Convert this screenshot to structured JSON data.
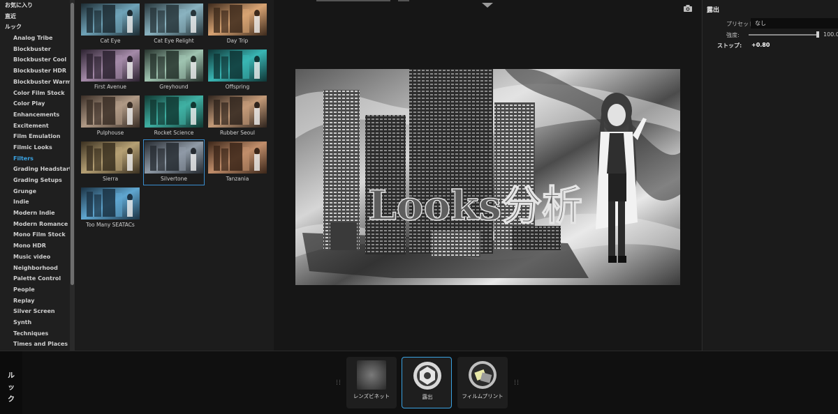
{
  "sidebar": {
    "categories": [
      {
        "label": "お気に入り"
      },
      {
        "label": "直近"
      },
      {
        "label": "ルック"
      }
    ],
    "items": [
      {
        "label": "Analog Tribe"
      },
      {
        "label": "Blockbuster"
      },
      {
        "label": "Blockbuster Cool"
      },
      {
        "label": "Blockbuster HDR"
      },
      {
        "label": "Blockbuster Warm"
      },
      {
        "label": "Color Film Stock"
      },
      {
        "label": "Color Play"
      },
      {
        "label": "Enhancements"
      },
      {
        "label": "Excitement"
      },
      {
        "label": "Film Emulation"
      },
      {
        "label": "Filmic Looks"
      },
      {
        "label": "Filters",
        "active": true
      },
      {
        "label": "Grading Headstarts"
      },
      {
        "label": "Grading Setups"
      },
      {
        "label": "Grunge"
      },
      {
        "label": "Indie"
      },
      {
        "label": "Modern Indie"
      },
      {
        "label": "Modern Romance"
      },
      {
        "label": "Mono Film Stock"
      },
      {
        "label": "Mono HDR"
      },
      {
        "label": "Music video"
      },
      {
        "label": "Neighborhood"
      },
      {
        "label": "Palette Control"
      },
      {
        "label": "People"
      },
      {
        "label": "Replay"
      },
      {
        "label": "Silver Screen"
      },
      {
        "label": "Synth"
      },
      {
        "label": "Techniques"
      },
      {
        "label": "Times and Places"
      }
    ]
  },
  "looks": [
    {
      "label": "Cat Eye",
      "tint": "#6fa3b8",
      "tone": "#1d2c33"
    },
    {
      "label": "Cat Eye Relight",
      "tint": "#8ab3c0",
      "tone": "#27353a"
    },
    {
      "label": "Day Trip",
      "tint": "#d7a373",
      "tone": "#3d2a1c"
    },
    {
      "label": "First Avenue",
      "tint": "#a48aa8",
      "tone": "#2c2230"
    },
    {
      "label": "Greyhound",
      "tint": "#9fc3b0",
      "tone": "#26322c"
    },
    {
      "label": "Offspring",
      "tint": "#39b5b3",
      "tone": "#0f3535"
    },
    {
      "label": "Pulphouse",
      "tint": "#b09a86",
      "tone": "#3a2e26"
    },
    {
      "label": "Rocket Science",
      "tint": "#3fb0a3",
      "tone": "#113832"
    },
    {
      "label": "Rubber Seoul",
      "tint": "#c39a78",
      "tone": "#2f241d"
    },
    {
      "label": "Sierra",
      "tint": "#b5a074",
      "tone": "#3a3020"
    },
    {
      "label": "Silvertone",
      "tint": "#8f9aa6",
      "tone": "#262b31",
      "selected": true
    },
    {
      "label": "Tanzania",
      "tint": "#c08d6a",
      "tone": "#3b2619"
    },
    {
      "label": "Too Many SEATACs",
      "tint": "#5fa6d0",
      "tone": "#1b3243"
    }
  ],
  "viewer": {
    "overlay_text": "Looks分析",
    "camera_icon": "camera-icon"
  },
  "inspector": {
    "title": "露出",
    "preset_label": "プリセット:",
    "preset_value": "なし",
    "intensity_label": "強度:",
    "intensity_value": "100.0",
    "intensity_level": 1.0,
    "stop_label": "ストップ:",
    "stop_value": "+0.80"
  },
  "bottom": {
    "side_tab": [
      "ル",
      "ッ",
      "ク"
    ],
    "effects": [
      {
        "label": "レンズビネット",
        "icon": "vignette-icon"
      },
      {
        "label": "露出",
        "icon": "aperture-icon",
        "selected": true
      },
      {
        "label": "フィルムプリント",
        "icon": "film-reel-icon"
      }
    ]
  },
  "colors": {
    "accent": "#3aa3e3",
    "panel": "#1c1c1c",
    "viewer_bg": "#161616"
  }
}
